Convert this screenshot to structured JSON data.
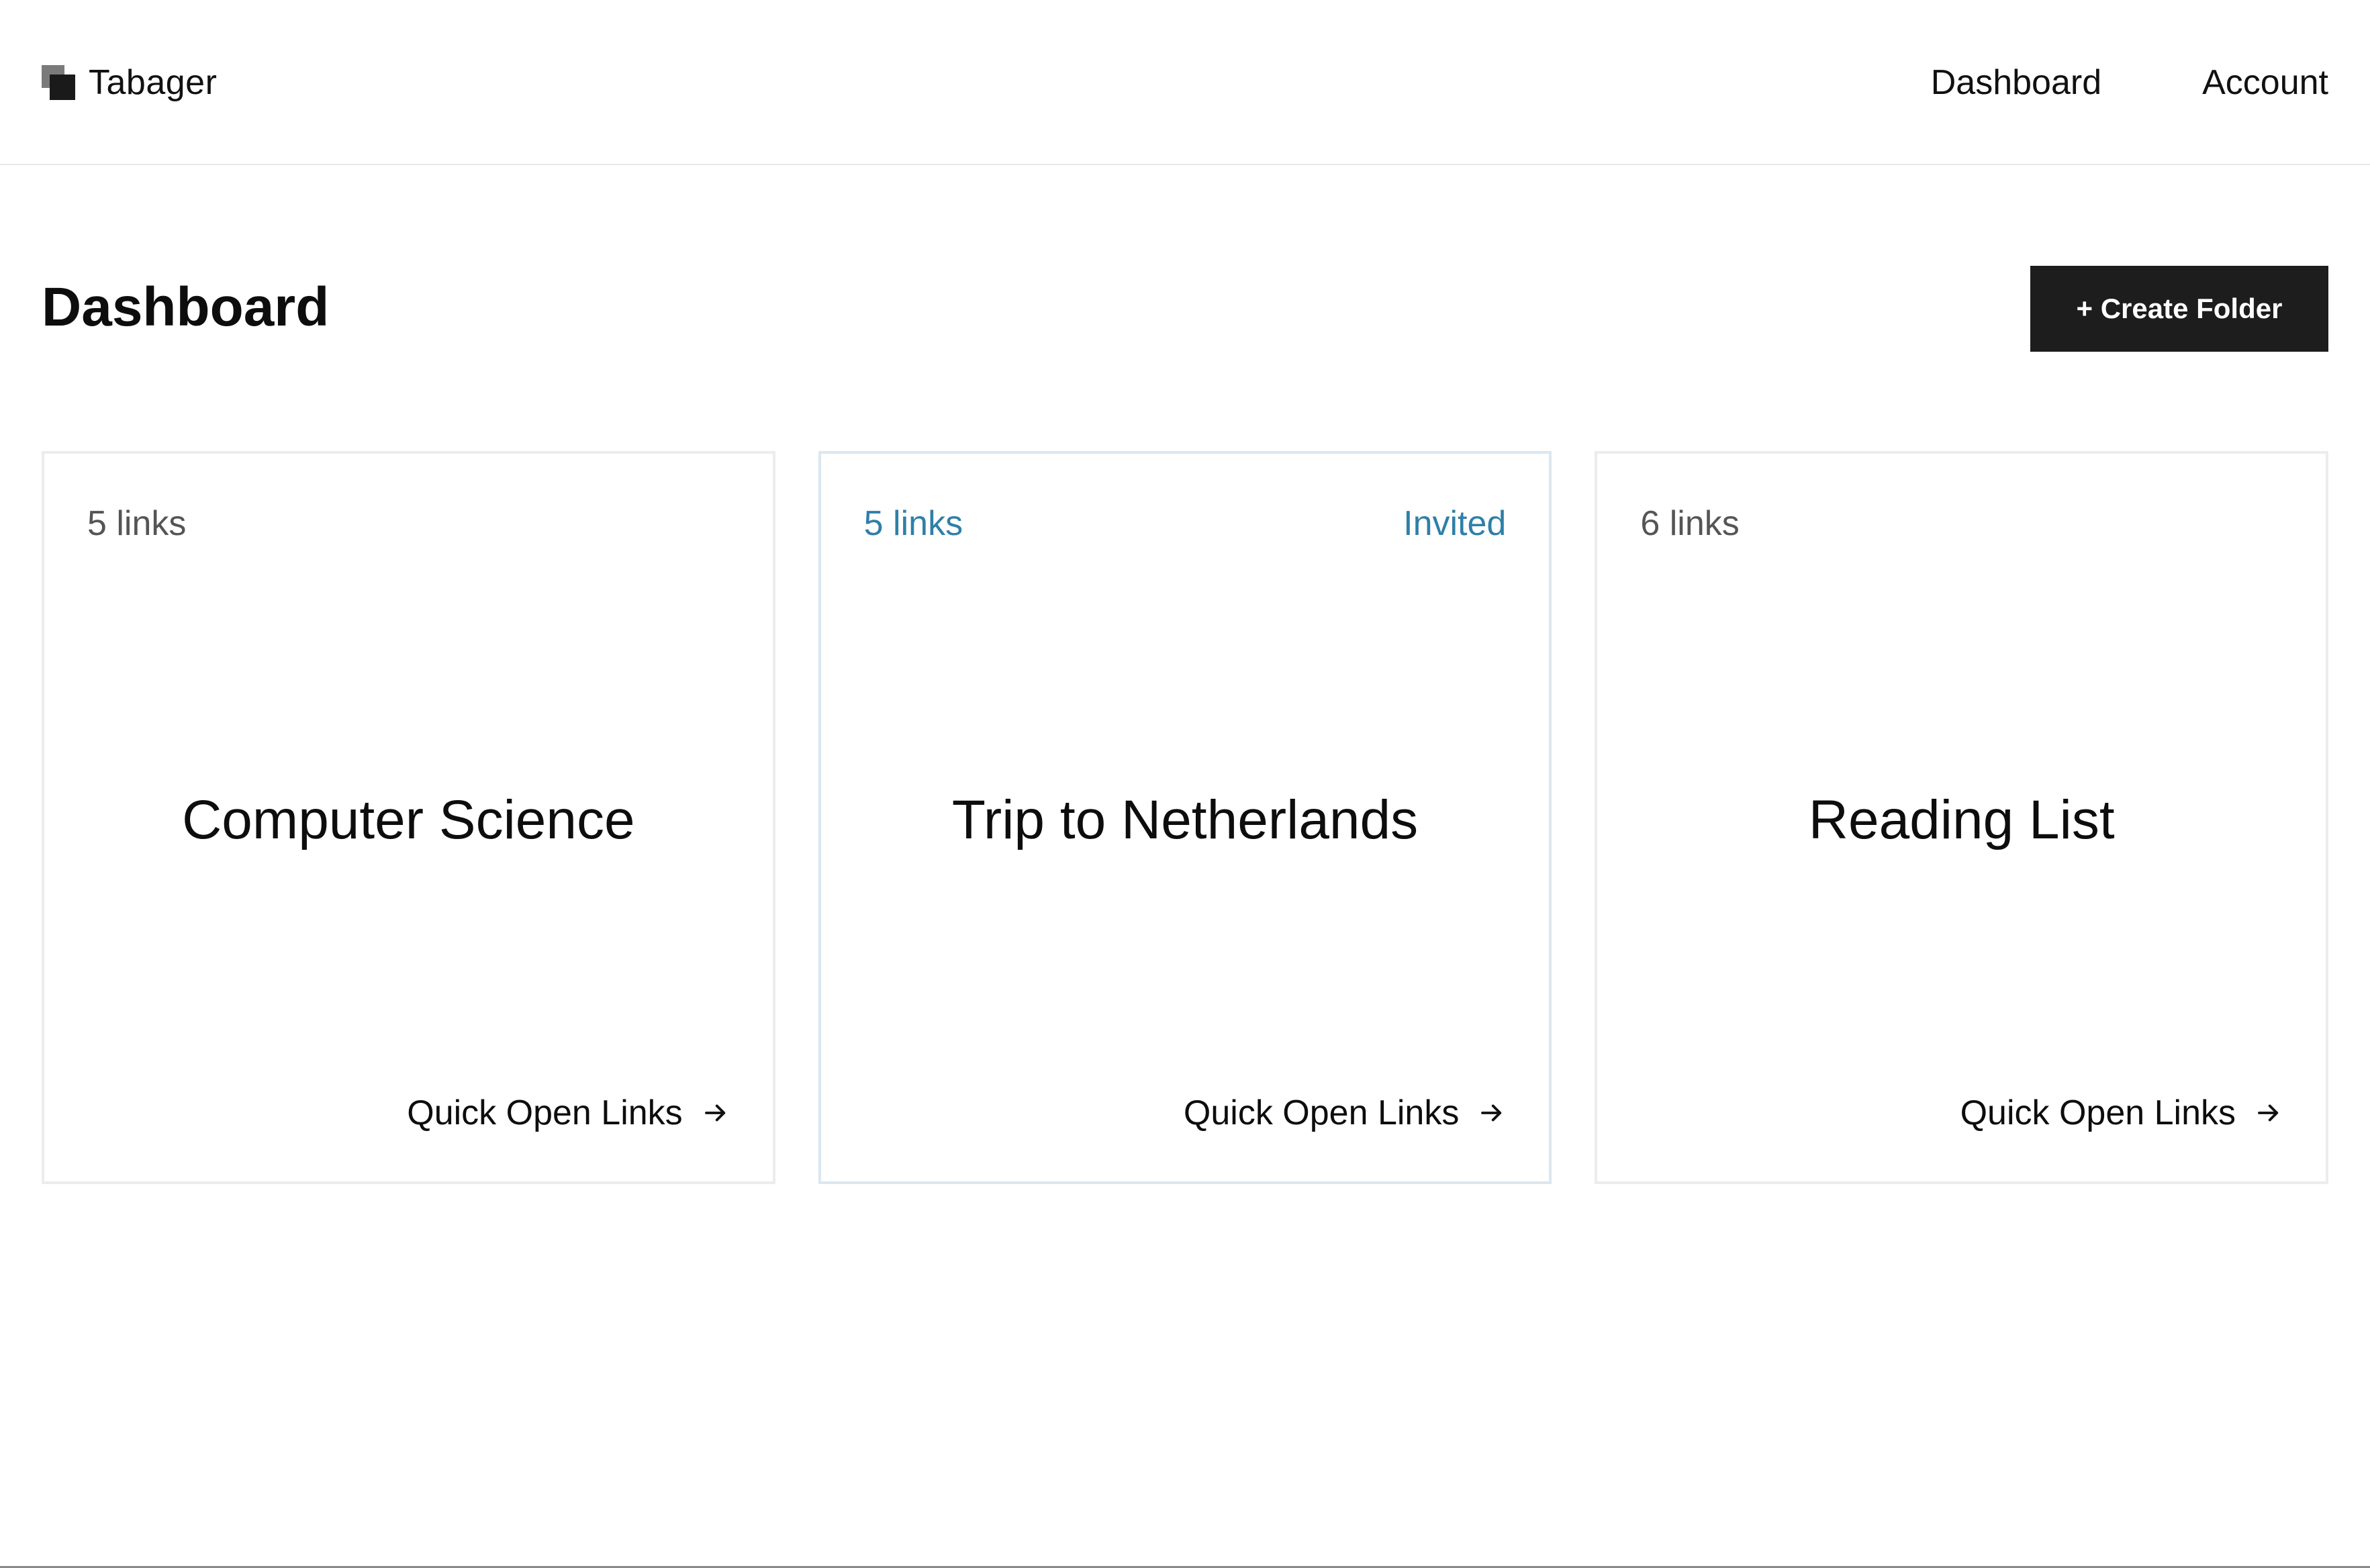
{
  "header": {
    "brand": "Tabager",
    "logo_icon": "stacked-squares-icon",
    "nav": [
      {
        "label": "Dashboard"
      },
      {
        "label": "Account"
      }
    ]
  },
  "main": {
    "title": "Dashboard",
    "create_button": "+ Create Folder",
    "folders": [
      {
        "count": "5 links",
        "name": "Computer Science",
        "badge": "",
        "action": "Quick Open Links"
      },
      {
        "count": "5 links",
        "name": "Trip to Netherlands",
        "badge": "Invited",
        "action": "Quick Open Links"
      },
      {
        "count": "6 links",
        "name": "Reading List",
        "badge": "",
        "action": "Quick Open Links"
      }
    ]
  },
  "colors": {
    "accent_invited": "#2f7fa8",
    "button_bg": "#1d1d1d",
    "card_border": "#ececec",
    "invited_border": "#dbe7f0"
  }
}
